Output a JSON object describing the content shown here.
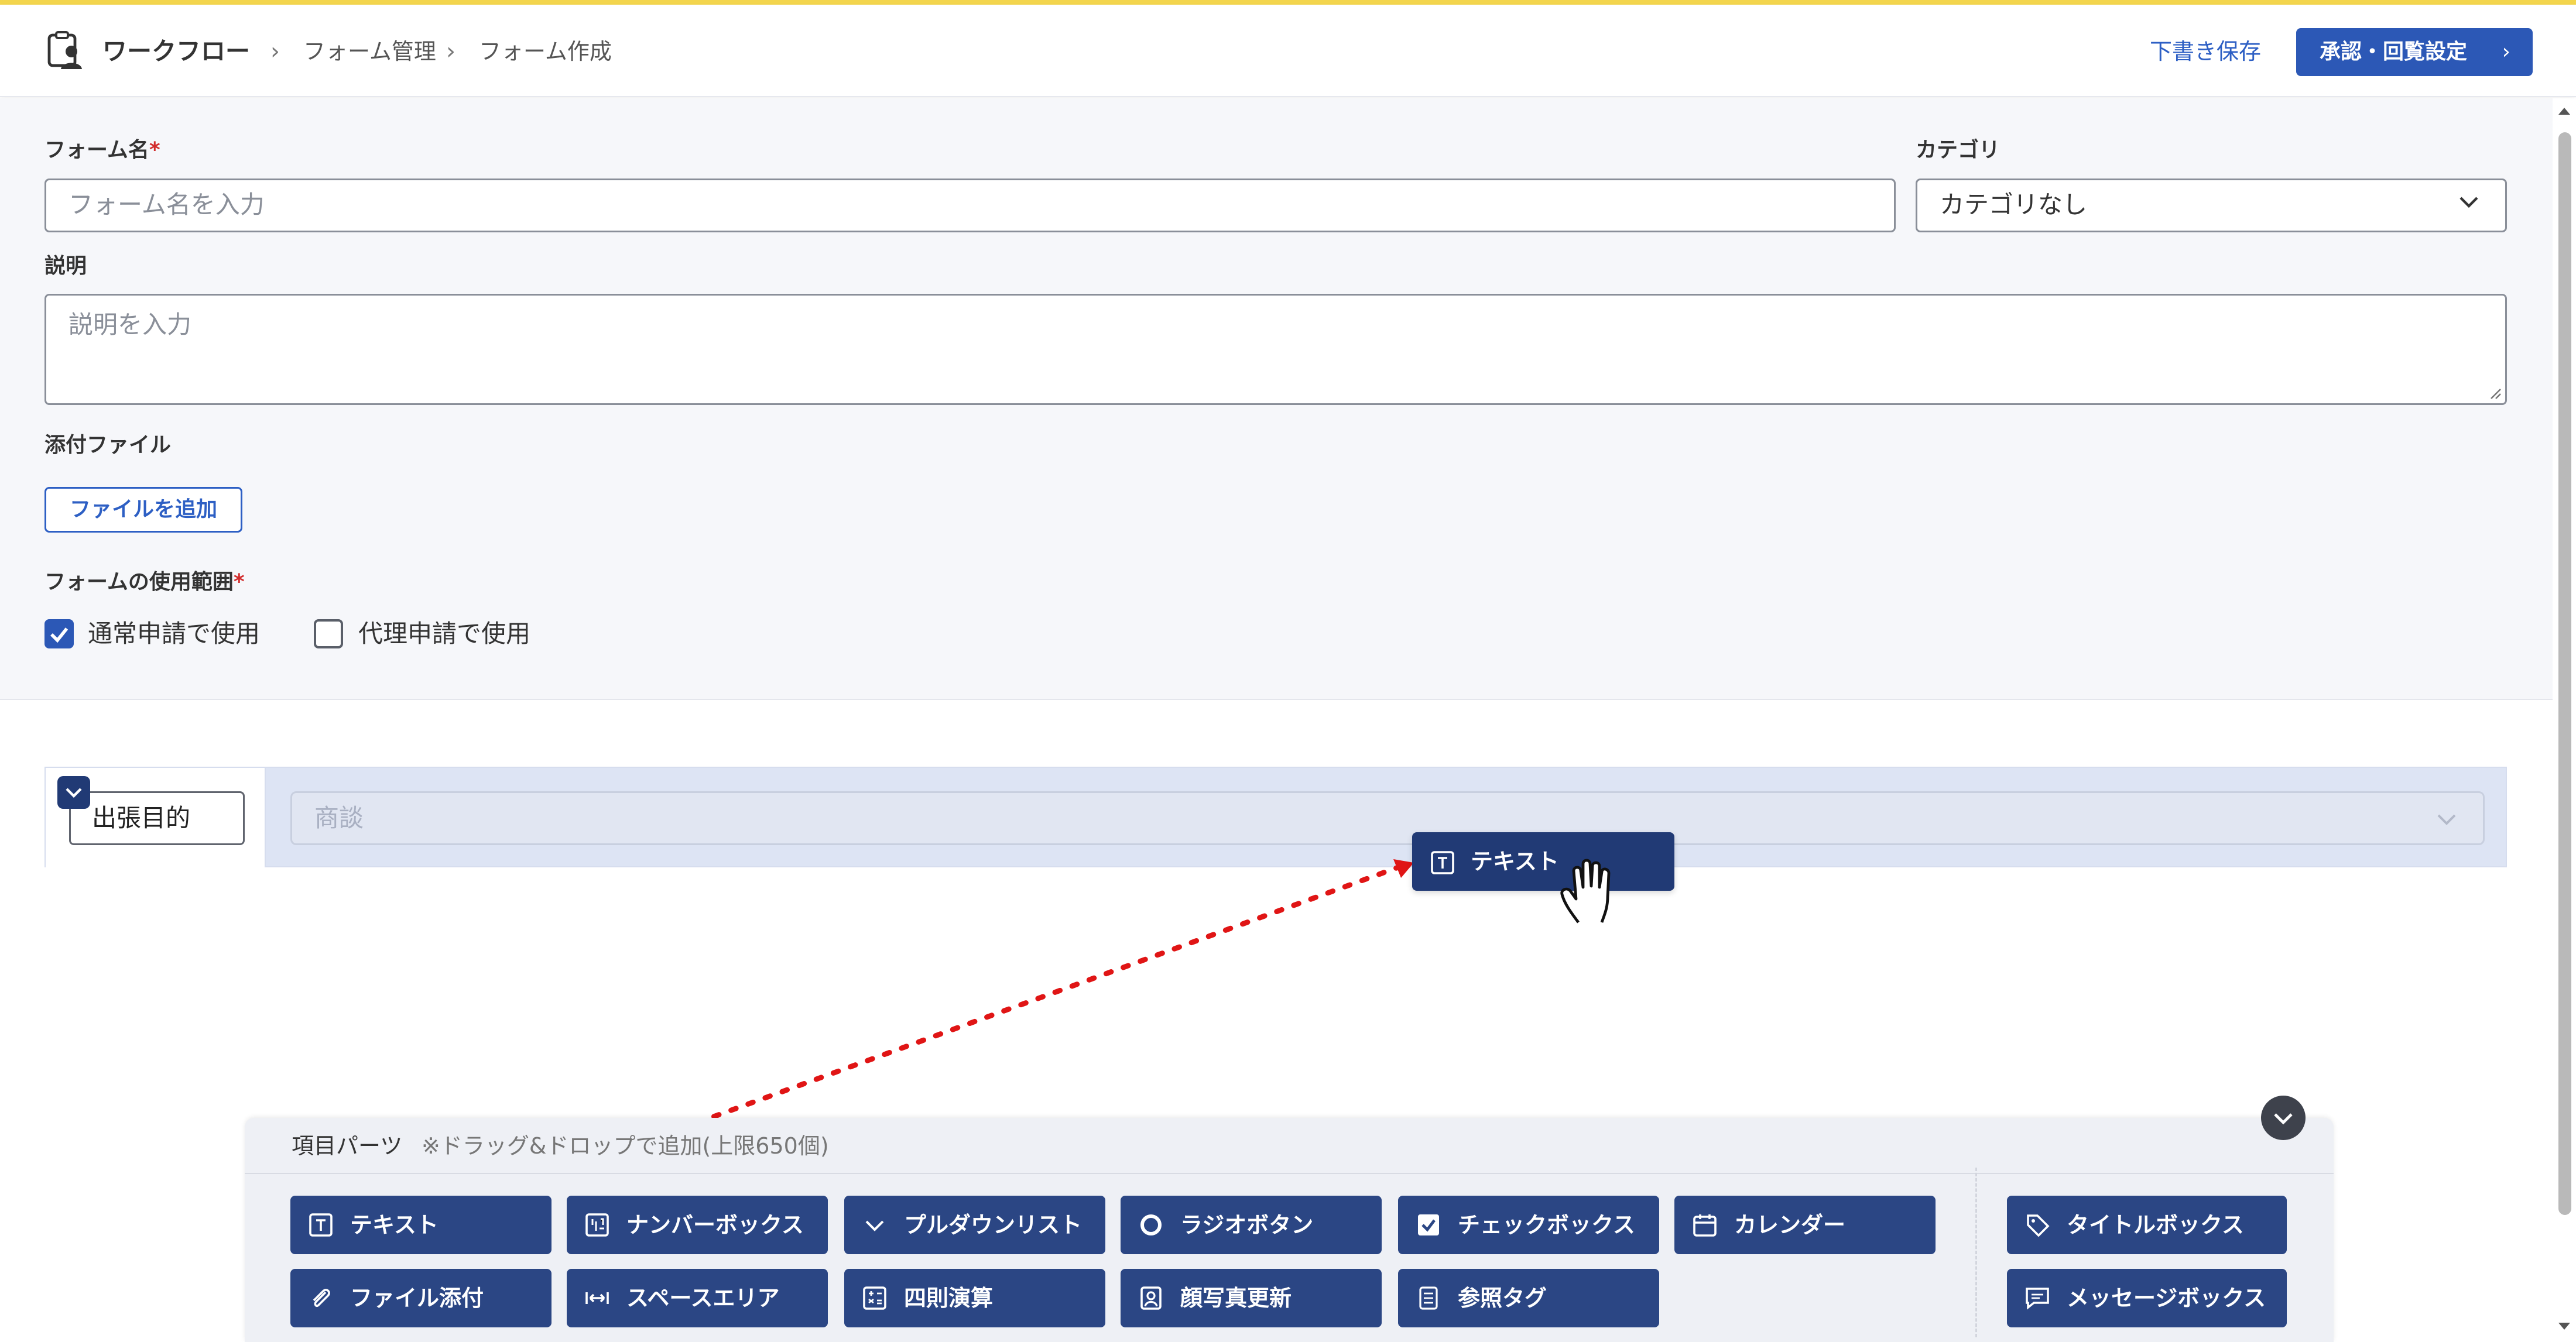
{
  "header": {
    "app_title": "ワークフロー",
    "breadcrumbs": [
      "フォーム管理",
      "フォーム作成"
    ],
    "draft_label": "下書き保存",
    "approve_label": "承認・回覧設定"
  },
  "form": {
    "name_label": "フォーム名",
    "required_mark": "*",
    "name_placeholder": "フォーム名を入力",
    "category_label": "カテゴリ",
    "category_value": "カテゴリなし",
    "desc_label": "説明",
    "desc_placeholder": "説明を入力",
    "attach_label": "添付ファイル",
    "add_file_label": "ファイルを追加",
    "usage_label": "フォームの使用範囲",
    "usage_options": [
      {
        "label": "通常申請で使用",
        "checked": true
      },
      {
        "label": "代理申請で使用",
        "checked": false
      }
    ]
  },
  "field_row": {
    "label": "出張目的",
    "select_value": "商談"
  },
  "drag_chip": {
    "label": "テキスト"
  },
  "palette": {
    "title": "項目パーツ",
    "note": "※ドラッグ&ドロップで追加(上限650個)",
    "parts_row1": [
      {
        "label": "テキスト",
        "icon": "text-icon"
      },
      {
        "label": "ナンバーボックス",
        "icon": "number-box-icon"
      },
      {
        "label": "プルダウンリスト",
        "icon": "chevron-down-icon"
      },
      {
        "label": "ラジオボタン",
        "icon": "radio-icon"
      },
      {
        "label": "チェックボックス",
        "icon": "checkbox-icon"
      },
      {
        "label": "カレンダー",
        "icon": "calendar-icon"
      }
    ],
    "parts_row2": [
      {
        "label": "ファイル添付",
        "icon": "paperclip-icon"
      },
      {
        "label": "スペースエリア",
        "icon": "space-icon"
      },
      {
        "label": "四則演算",
        "icon": "calculator-icon"
      },
      {
        "label": "顔写真更新",
        "icon": "portrait-icon"
      },
      {
        "label": "参照タグ",
        "icon": "reference-icon"
      }
    ],
    "parts_side": [
      {
        "label": "タイトルボックス",
        "icon": "tag-icon"
      },
      {
        "label": "メッセージボックス",
        "icon": "message-icon"
      }
    ]
  },
  "colors": {
    "primary": "#2c58b6",
    "part_bg": "#2b4684",
    "drag_chip_bg": "#213a75",
    "required": "#d22c2c",
    "accent_line": "#f3d54d",
    "drag_arrow": "#e01515"
  }
}
